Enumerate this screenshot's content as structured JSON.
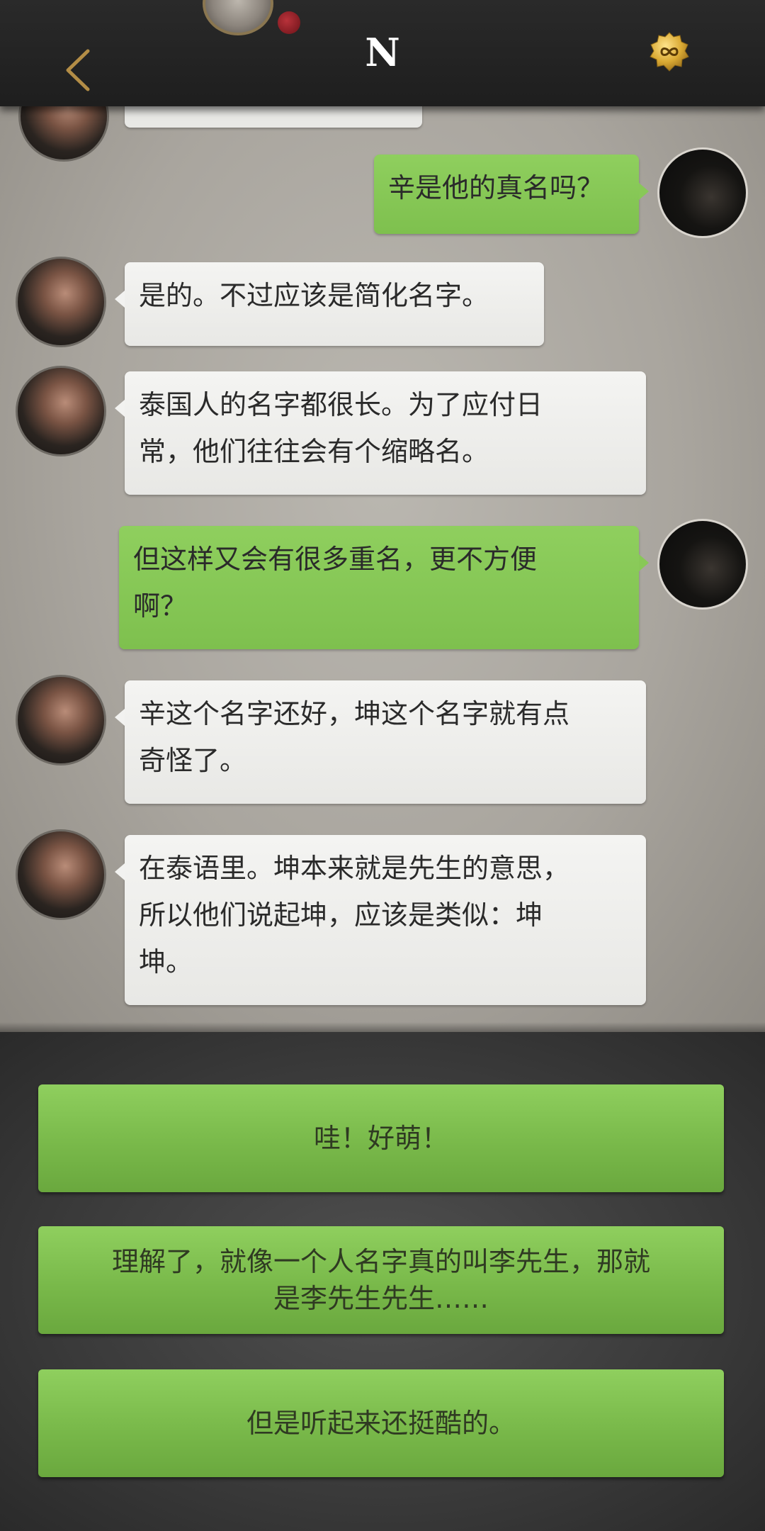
{
  "header": {
    "title": "N",
    "back_icon": "chevron-left-icon",
    "badge_icon": "infinity-badge-icon"
  },
  "messages": [
    {
      "side": "right",
      "text": "辛是他的真名吗？"
    },
    {
      "side": "left",
      "text": "是的。不过应该是简化名字。"
    },
    {
      "side": "left",
      "lines": [
        "泰国人的名字都很长。为了应付日",
        "常，他们往往会有个缩略名。"
      ]
    },
    {
      "side": "right",
      "lines": [
        "但这样又会有很多重名，更不方便",
        "啊？"
      ]
    },
    {
      "side": "left",
      "lines": [
        "辛这个名字还好，坤这个名字就有点",
        "奇怪了。"
      ]
    },
    {
      "side": "left",
      "lines": [
        "在泰语里。坤本来就是先生的意思，",
        "所以他们说起坤，应该是类似：坤",
        "坤。"
      ]
    }
  ],
  "options": [
    {
      "text": "哇！好萌！"
    },
    {
      "lines": [
        "理解了，就像一个人名字真的叫李先生，那就",
        "是李先生先生……"
      ]
    },
    {
      "text": "但是听起来还挺酷的。"
    }
  ],
  "colors": {
    "bubble_green": "#8fcf5e",
    "bubble_white": "#f4f4f2",
    "header_bg": "#222222",
    "accent_gold": "#d6a93a"
  }
}
